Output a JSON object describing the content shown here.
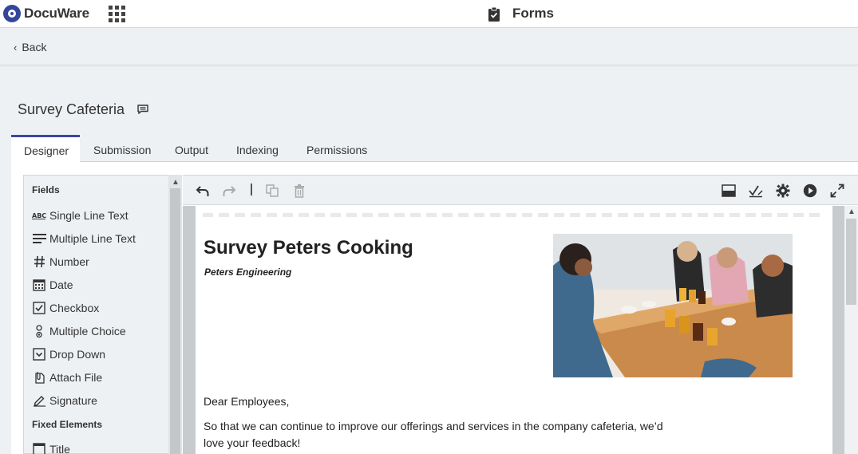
{
  "app": {
    "brand": "DocuWare",
    "section_title": "Forms"
  },
  "nav": {
    "back_label": "Back"
  },
  "form": {
    "name": "Survey Cafeteria"
  },
  "tabs": [
    {
      "label": "Designer",
      "active": true
    },
    {
      "label": "Submission",
      "active": false
    },
    {
      "label": "Output",
      "active": false
    },
    {
      "label": "Indexing",
      "active": false
    },
    {
      "label": "Permissions",
      "active": false
    }
  ],
  "fields_panel": {
    "fields_heading": "Fields",
    "fields": [
      {
        "label": "Single Line Text",
        "icon": "abc-icon"
      },
      {
        "label": "Multiple Line Text",
        "icon": "multiline-icon"
      },
      {
        "label": "Number",
        "icon": "hash-icon"
      },
      {
        "label": "Date",
        "icon": "calendar-icon"
      },
      {
        "label": "Checkbox",
        "icon": "checkbox-icon"
      },
      {
        "label": "Multiple Choice",
        "icon": "radio-icon"
      },
      {
        "label": "Drop Down",
        "icon": "dropdown-icon"
      },
      {
        "label": "Attach File",
        "icon": "attach-icon"
      },
      {
        "label": "Signature",
        "icon": "signature-icon"
      }
    ],
    "fixed_heading": "Fixed Elements",
    "fixed": [
      {
        "label": "Title",
        "icon": "title-icon"
      }
    ]
  },
  "canvas": {
    "title": "Survey Peters Cooking",
    "subtitle": "Peters Engineering",
    "greeting": "Dear Employees,",
    "body": "So that we can continue to improve our offerings and services in the company cafeteria, we’d love your feedback!"
  },
  "colors": {
    "accent": "#3b47a6",
    "brand": "#34469b"
  }
}
